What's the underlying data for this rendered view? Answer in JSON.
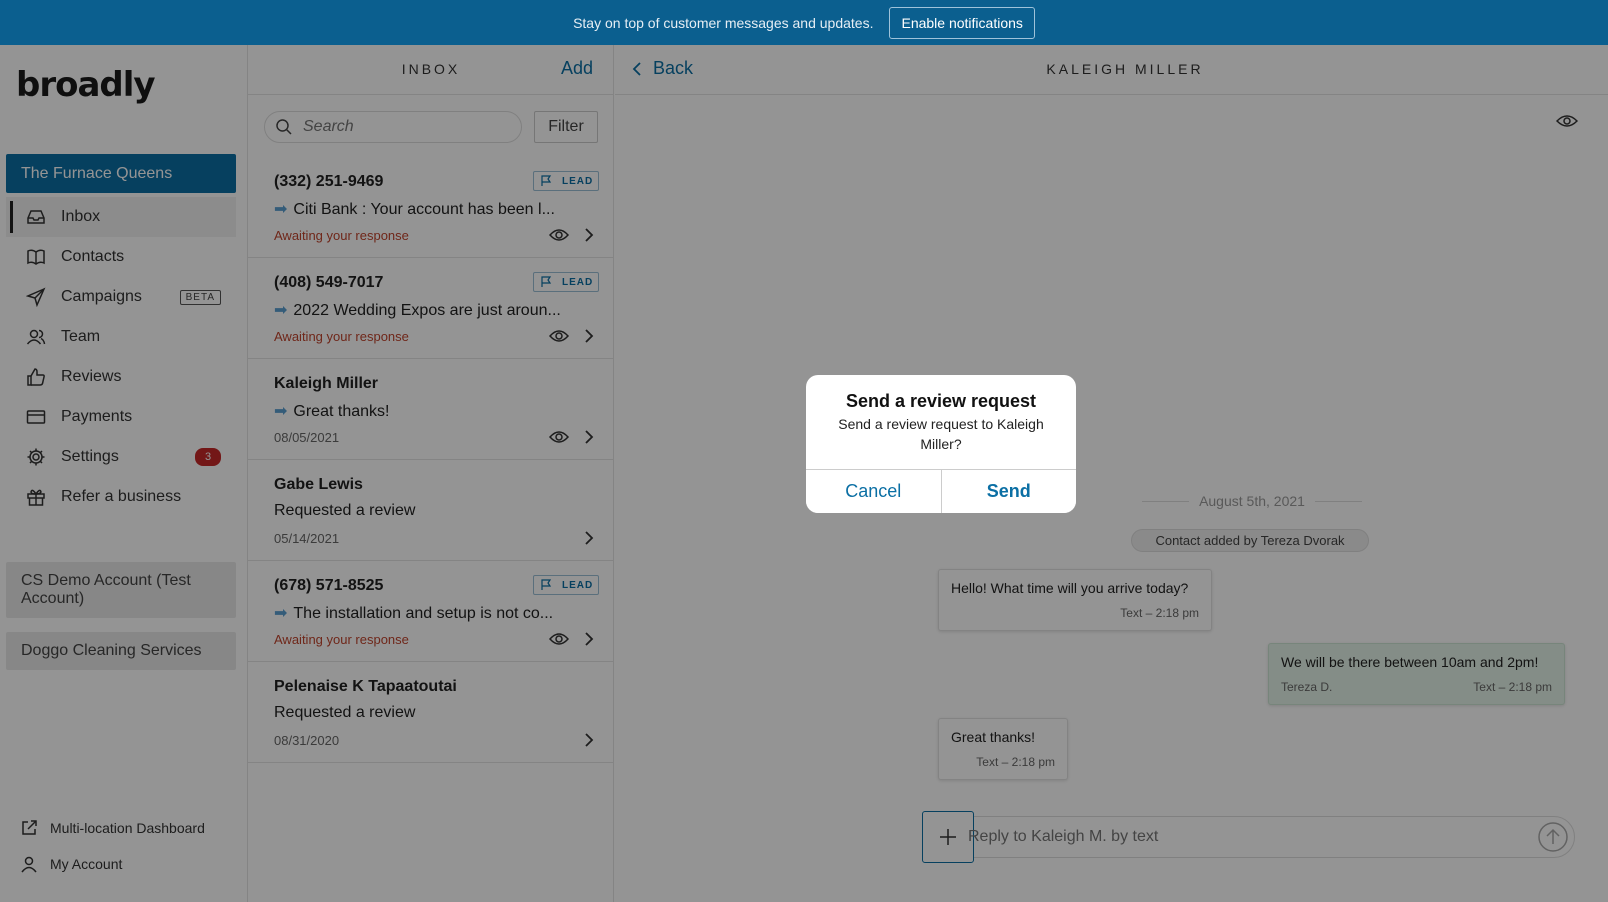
{
  "banner": {
    "text": "Stay on top of customer messages and updates.",
    "button_label": "Enable notifications"
  },
  "sidebar": {
    "logo": "broadly",
    "active_business": "The Furnace Queens",
    "items": [
      {
        "label": "Inbox",
        "icon": "inbox-icon"
      },
      {
        "label": "Contacts",
        "icon": "book-icon"
      },
      {
        "label": "Campaigns",
        "icon": "send-icon",
        "tag": "BETA"
      },
      {
        "label": "Team",
        "icon": "users-icon"
      },
      {
        "label": "Reviews",
        "icon": "thumbs-up-icon"
      },
      {
        "label": "Payments",
        "icon": "credit-card-icon"
      },
      {
        "label": "Settings",
        "icon": "gear-icon",
        "badge": "3"
      },
      {
        "label": "Refer a business",
        "icon": "gift-icon"
      }
    ],
    "other_businesses": [
      "CS Demo Account (Test Account)",
      "Doggo Cleaning Services"
    ],
    "footer": {
      "dashboard": "Multi-location Dashboard",
      "account": "My Account"
    }
  },
  "inbox": {
    "title": "INBOX",
    "add_label": "Add",
    "search_placeholder": "Search",
    "filter_label": "Filter",
    "lead_tag": "LEAD",
    "conversations": [
      {
        "name": "(332) 251-9469",
        "message": "Citi Bank : Your account has been l...",
        "status": "Awaiting your response"
      },
      {
        "name": "(408) 549-7017",
        "message": "2022 Wedding Expos are just aroun...",
        "status": "Awaiting your response"
      },
      {
        "name": "Kaleigh Miller",
        "message": "Great thanks!",
        "date": "08/05/2021"
      },
      {
        "name": "Gabe Lewis",
        "message": "Requested a review",
        "date": "05/14/2021"
      },
      {
        "name": "(678) 571-8525",
        "message": "The installation and setup is not co...",
        "status": "Awaiting your response"
      },
      {
        "name": "Pelenaise K Tapaatoutai",
        "message": "Requested a review",
        "date": "08/31/2020"
      }
    ]
  },
  "conversation": {
    "back_label": "Back",
    "title": "KALEIGH MILLER",
    "date_separator": "August 5th, 2021",
    "system_note": "Contact added by Tereza Dvorak",
    "messages": [
      {
        "text": "Hello! What time will you arrive today?",
        "channel": "Text",
        "time": "2:18 pm"
      },
      {
        "text": "We will be there between 10am and 2pm!",
        "sender": "Tereza D.",
        "channel": "Text",
        "time": "2:18 pm"
      },
      {
        "text": "Great thanks!",
        "channel": "Text",
        "time": "2:18 pm"
      }
    ],
    "reply_placeholder": "Reply to Kaleigh M. by text"
  },
  "modal": {
    "title": "Send a review request",
    "body": "Send a review request to Kaleigh Miller?",
    "cancel_label": "Cancel",
    "send_label": "Send"
  },
  "colors": {
    "brand": "#0b6fa4",
    "banner": "#0b5f8f",
    "awaiting": "#c0442d",
    "badge": "#c62828"
  }
}
